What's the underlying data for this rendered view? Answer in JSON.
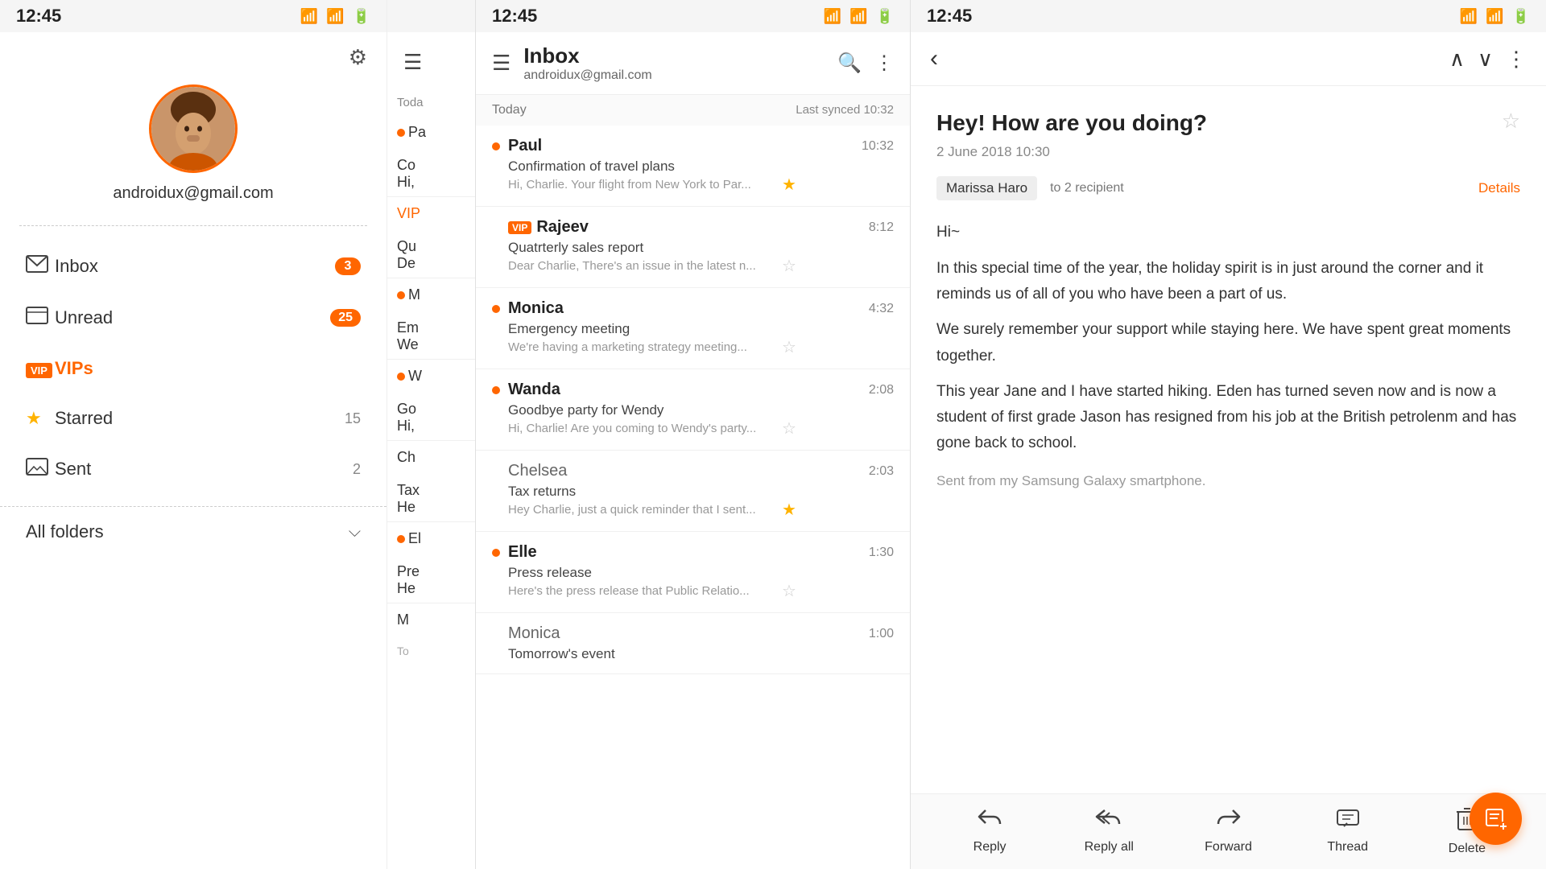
{
  "statusBar": {
    "time": "12:45"
  },
  "sidebar": {
    "email": "androidux@gmail.com",
    "gearLabel": "⚙",
    "navItems": [
      {
        "id": "inbox",
        "icon": "✉",
        "label": "Inbox",
        "badge": "3"
      },
      {
        "id": "unread",
        "icon": "✉",
        "label": "Unread",
        "badge": "25"
      },
      {
        "id": "vips",
        "icon": null,
        "label": "VIPs",
        "count": ""
      },
      {
        "id": "starred",
        "icon": "★",
        "label": "Starred",
        "count": "15"
      },
      {
        "id": "sent",
        "icon": "✉",
        "label": "Sent",
        "count": "2"
      }
    ],
    "allFolders": "All folders"
  },
  "inbox": {
    "title": "Inbox",
    "email": "androidux@gmail.com",
    "sectionLabel": "Today",
    "syncLabel": "Last synced 10:32",
    "emails": [
      {
        "sender": "Paul",
        "time": "10:32",
        "subject": "Confirmation of travel plans",
        "preview": "Hi, Charlie. Your flight from New York to Par...",
        "unread": true,
        "starred": true,
        "vip": false
      },
      {
        "sender": "Rajeev",
        "time": "8:12",
        "subject": "Quatrterly sales report",
        "preview": "Dear Charlie, There's an issue in the latest n...",
        "unread": false,
        "starred": false,
        "vip": true
      },
      {
        "sender": "Monica",
        "time": "4:32",
        "subject": "Emergency meeting",
        "preview": "We're having a marketing strategy meeting...",
        "unread": true,
        "starred": false,
        "vip": false
      },
      {
        "sender": "Wanda",
        "time": "2:08",
        "subject": "Goodbye party for Wendy",
        "preview": "Hi, Charlie! Are you coming to Wendy's party...",
        "unread": true,
        "starred": false,
        "vip": false
      },
      {
        "sender": "Chelsea",
        "time": "2:03",
        "subject": "Tax returns",
        "preview": "Hey Charlie, just a quick reminder that I sent...",
        "unread": false,
        "starred": true,
        "vip": false
      },
      {
        "sender": "Elle",
        "time": "1:30",
        "subject": "Press release",
        "preview": "Here's the press release that Public Relatio...",
        "unread": true,
        "starred": false,
        "vip": false
      },
      {
        "sender": "Monica",
        "time": "1:00",
        "subject": "Tomorrow's event",
        "preview": "",
        "unread": false,
        "starred": false,
        "vip": false
      }
    ]
  },
  "detail": {
    "subject": "Hey! How are you doing?",
    "date": "2 June 2018 10:30",
    "from": "Marissa Haro",
    "to": "to 2 recipient",
    "detailsLink": "Details",
    "body": [
      "Hi~",
      "In this special time of the year, the holiday spirit is in just around the corner and it reminds us of all of you who have been a part of us.",
      "We surely remember your support while staying here. We have spent great moments together.",
      "This year Jane and I have started hiking. Eden has turned seven now and is now a student of first grade Jason has resigned from his job at the British petrolenm and has gone back to school."
    ],
    "signature": "Sent from my Samsung Galaxy smartphone.",
    "actions": {
      "reply": "Reply",
      "replyAll": "Reply all",
      "forward": "Forward",
      "thread": "Thread",
      "delete": "Delete"
    }
  },
  "partial": {
    "menuItems": [
      "Pa",
      "M",
      "W",
      "Ch",
      "El",
      "M"
    ]
  }
}
